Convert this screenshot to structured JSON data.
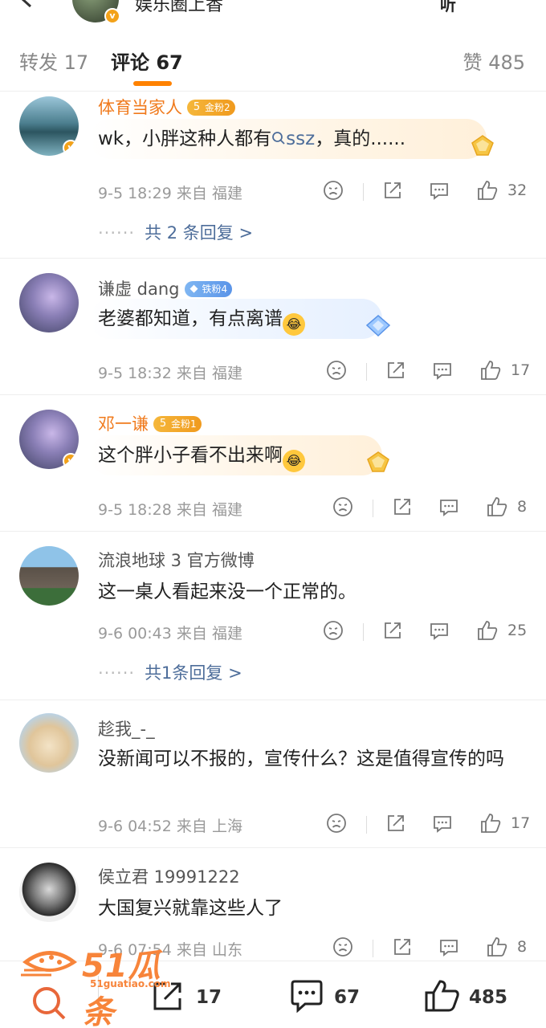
{
  "header": {
    "title": "娱乐圈上香",
    "listen_label": "听",
    "more_label": "···"
  },
  "tabs": {
    "forward_label": "转发",
    "forward_count": "17",
    "comment_label": "评论",
    "comment_count": "67",
    "like_label": "赞",
    "like_count": "485"
  },
  "comments": [
    {
      "name": "体育当家人",
      "badge": "金粉2",
      "badge_level": "5",
      "text_prefix": "wk，小胖这种人都有",
      "search_term": "ssz",
      "text_suffix": "，真的......",
      "time": "9-5 18:29",
      "from": "来自",
      "location": "福建",
      "likes": "32",
      "replies": "共 2 条回复 >"
    },
    {
      "name": "谦虚 dang",
      "badge": "铁粉4",
      "text": "老婆都知道，有点离谱",
      "time": "9-5 18:32",
      "from": "来自",
      "location": "福建",
      "likes": "17"
    },
    {
      "name": "邓一谦",
      "badge": "金粉1",
      "badge_level": "5",
      "text": "这个胖小子看不出来啊",
      "time": "9-5 18:28",
      "from": "来自",
      "location": "福建",
      "likes": "8"
    },
    {
      "name": "流浪地球 3 官方微博",
      "text": "这一桌人看起来没一个正常的。",
      "time": "9-6 00:43",
      "from": "来自",
      "location": "福建",
      "likes": "25",
      "replies": "共1条回复 >"
    },
    {
      "name": "趁我_-_",
      "text": "没新闻可以不报的，宣传什么？这是值得宣传的吗",
      "time": "9-6 04:52",
      "from": "来自",
      "location": "上海",
      "likes": "17"
    },
    {
      "name": "侯立君 19991222",
      "text": "大国复兴就靠这些人了",
      "time": "9-6 07:54",
      "from": "来自",
      "location": "山东",
      "likes": "8"
    }
  ],
  "bottom_bar": {
    "forward_count": "17",
    "comment_count": "67",
    "like_count": "485"
  },
  "watermark": {
    "brand": "51瓜条",
    "url": "51guatiao.com"
  },
  "colors": {
    "accent": "#ff8200",
    "vip_name": "#f07a1c",
    "link_blue": "#4d6d9a"
  }
}
